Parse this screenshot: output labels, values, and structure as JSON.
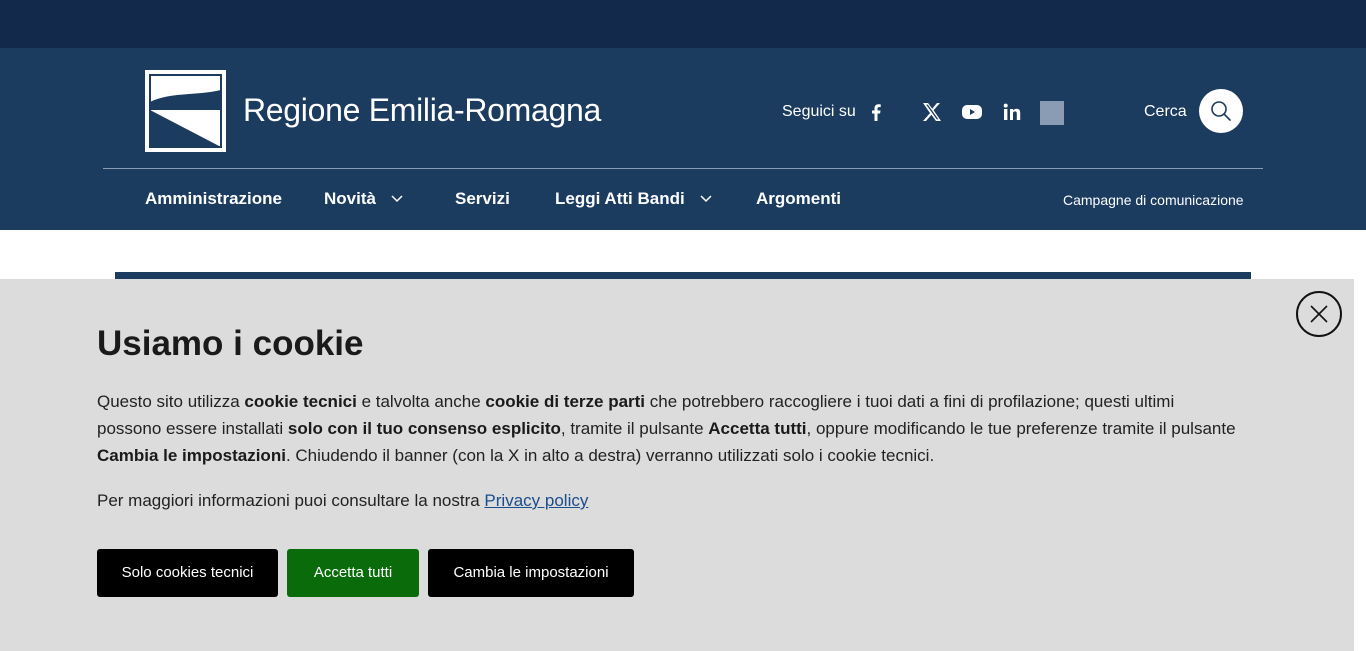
{
  "site": {
    "title": "Regione Emilia-Romagna"
  },
  "social": {
    "label": "Seguici su",
    "items": [
      "facebook-icon",
      "x-twitter-icon",
      "youtube-icon",
      "linkedin-icon",
      "placeholder-icon"
    ]
  },
  "search": {
    "label": "Cerca"
  },
  "nav": {
    "items": [
      {
        "label": "Amministrazione",
        "has_dropdown": false
      },
      {
        "label": "Novità",
        "has_dropdown": true
      },
      {
        "label": "Servizi",
        "has_dropdown": false
      },
      {
        "label": "Leggi Atti Bandi",
        "has_dropdown": true
      },
      {
        "label": "Argomenti",
        "has_dropdown": false
      }
    ],
    "secondary": "Campagne di comunicazione"
  },
  "cookie": {
    "title": "Usiamo i cookie",
    "p1": [
      "Questo sito utilizza ",
      "cookie tecnici",
      " e talvolta anche ",
      "cookie di terze parti",
      " che potrebbero raccogliere i tuoi dati a fini di profilazione; questi ultimi possono essere installati ",
      "solo con il tuo consenso esplicito",
      ", tramite il pulsante ",
      "Accetta tutti",
      ", oppure modificando le tue preferenze tramite il pulsante ",
      "Cambia le impostazioni",
      ". Chiudendo il banner (con la X in alto a destra) verranno utilizzati solo i cookie tecnici."
    ],
    "more_prefix": "Per maggiori informazioni puoi consultare la nostra ",
    "privacy_link": "Privacy policy",
    "buttons": {
      "technical": "Solo cookies tecnici",
      "accept_all": "Accetta tutti",
      "settings": "Cambia le impostazioni"
    }
  },
  "colors": {
    "topbar": "#13294b",
    "header": "#1b3b5f",
    "accept": "#0a6b0a",
    "panel": "#dcdcdc"
  }
}
